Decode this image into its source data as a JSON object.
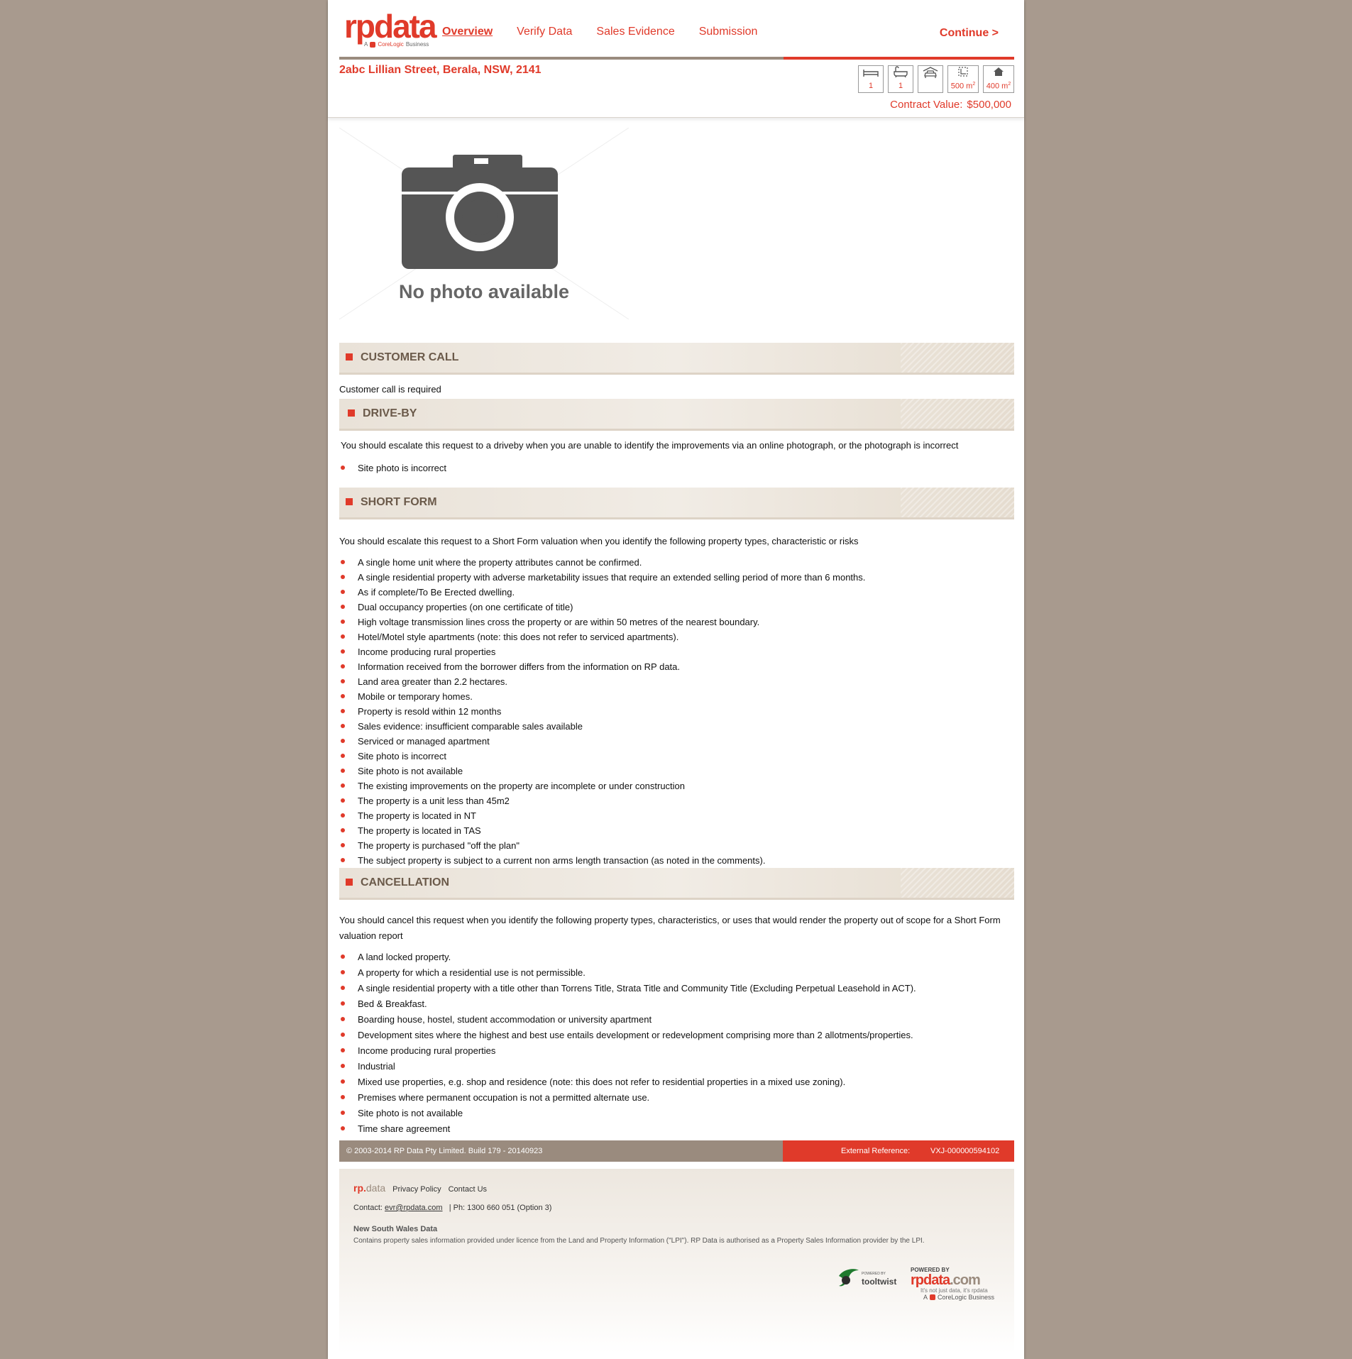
{
  "brand": {
    "name": "rpdata",
    "sub_prefix": "A",
    "sub_brand": "CoreLogic",
    "sub_suffix": "Business"
  },
  "nav": {
    "items": [
      {
        "label": "Overview",
        "active": true
      },
      {
        "label": "Verify Data",
        "active": false
      },
      {
        "label": "Sales Evidence",
        "active": false
      },
      {
        "label": "Submission",
        "active": false
      }
    ],
    "continue_label": "Continue >",
    "progress": 0.33
  },
  "property": {
    "address": "2abc Lillian Street, Berala, NSW, 2141",
    "bedrooms": "1",
    "bathrooms": "1",
    "car_spaces": "",
    "land_area": "500 m",
    "floor_area": "400 m",
    "area_sup": "2",
    "contract_label": "Contract Value:",
    "contract_value": "$500,000"
  },
  "photo": {
    "placeholder_text": "No photo available"
  },
  "sections": {
    "customer_call": {
      "title": "CUSTOMER CALL",
      "text": "Customer call is required"
    },
    "drive_by": {
      "title": "DRIVE-BY",
      "text": "You should escalate this request to a driveby when you are unable to identify the improvements via an online photograph, or the photograph is incorrect",
      "items": [
        "Site photo is incorrect"
      ]
    },
    "short_form": {
      "title": "SHORT FORM",
      "text": "You should escalate this request to a Short Form valuation when you identify the following property types, characteristic or risks",
      "items": [
        "A single home unit where the property attributes cannot be confirmed.",
        "A single residential property with adverse marketability issues that require an extended selling period of more than 6 months.",
        "As if complete/To Be Erected dwelling.",
        "Dual occupancy properties (on one certificate of title)",
        "High voltage transmission lines cross the property or are within 50 metres of the nearest boundary.",
        "Hotel/Motel style apartments (note: this does not refer to serviced apartments).",
        "Income producing rural properties",
        "Information received from the borrower differs from the information on RP data.",
        "Land area greater than 2.2 hectares.",
        "Mobile or temporary homes.",
        "Property is resold within 12 months",
        "Sales evidence: insufficient comparable sales available",
        "Serviced or managed apartment",
        "Site photo is incorrect",
        "Site photo is not available",
        "The existing improvements on the property are incomplete or under construction",
        "The property is a unit less than 45m2",
        "The property is located in NT",
        "The property is located in TAS",
        "The property is purchased \"off the plan\"",
        "The subject property is subject to a current non arms length transaction (as noted in the comments)."
      ]
    },
    "cancellation": {
      "title": "CANCELLATION",
      "text": "You should cancel this request when you identify the following property types, characteristics, or uses that would render the property out of scope for a Short Form valuation report",
      "items": [
        "A land locked property.",
        "A property for which a residential use is not permissible.",
        "A single residential property with a title other than Torrens Title, Strata Title and Community Title (Excluding Perpetual Leasehold in ACT).",
        "Bed & Breakfast.",
        "Boarding house, hostel, student accommodation or university apartment",
        "Development sites where the highest and best use entails development or redevelopment comprising more than 2 allotments/properties.",
        "Income producing rural properties",
        "Industrial",
        "Mixed use properties, e.g. shop and residence (note: this does not refer to residential properties in a mixed use zoning).",
        "Premises where permanent occupation is not a permitted alternate use.",
        "Site photo is not available",
        "Time share agreement"
      ]
    }
  },
  "footer_bar": {
    "copyright": "© 2003-2014 RP Data Pty Limited.  Build 179 - 20140923",
    "ext_ref_label": "External Reference:",
    "ext_ref_value": "VXJ-000000594102"
  },
  "footer": {
    "logo_rp": "rp.",
    "logo_data": "data",
    "privacy_label": "Privacy Policy",
    "contact_us_label": "Contact Us",
    "contact_prefix": "Contact:",
    "contact_email": "evr@rpdata.com",
    "contact_phone": "|   Ph: 1300 660 051 (Option 3)",
    "nsw_heading": "New South Wales Data",
    "nsw_text": "Contains property sales information provided under licence from the Land and Property Information (\"LPI\"). RP Data is authorised as a Property Sales Information provider by the LPI.",
    "tooltwist_powered": "POWERED BY",
    "tooltwist_name": "tooltwist",
    "rp_powered": "POWERED BY",
    "rp_name_a": "rpdata",
    "rp_name_b": ".com",
    "rp_tagline": "It's not just data, it's rpdata",
    "rp_cl_prefix": "A",
    "rp_cl_name": "CoreLogic Business"
  },
  "colors": {
    "accent": "#e03a2a",
    "taupe": "#9a8b7e",
    "background": "#a89a8e"
  }
}
